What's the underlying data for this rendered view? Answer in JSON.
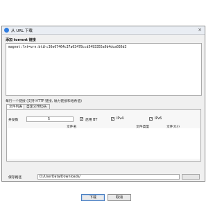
{
  "window": {
    "title": "从 URL 下载",
    "close_glyph": "×"
  },
  "torrent": {
    "label": "添加 torrent 链接",
    "magnet_link": "magnet:?xt=urn:btih:36e67464c37a03478ccd5493355a9b4dca036d3"
  },
  "hint": "每行一个链接 (支持 HTTP 链接, 磁力链接和哈希值)",
  "tabs": [
    {
      "label": "文件列表"
    },
    {
      "label": "自定义Http头"
    }
  ],
  "panel": {
    "concurrent_label": "并发数",
    "concurrent_value": "5",
    "checkboxes": [
      {
        "label": "启用 BT",
        "checked": true
      },
      {
        "label": "IPv4",
        "checked": true
      },
      {
        "label": "IPv6",
        "checked": true
      }
    ],
    "columns": [
      "文件名",
      "文件类型",
      "文件大小"
    ]
  },
  "save": {
    "label": "保存路径",
    "path": "D:/UserData/Downloads/"
  },
  "buttons": {
    "download": "下载",
    "cancel": "取消"
  },
  "colors": {
    "accent": "#2f7de1",
    "window_bg": "#f0f0f0",
    "border": "#a9a9a9"
  }
}
